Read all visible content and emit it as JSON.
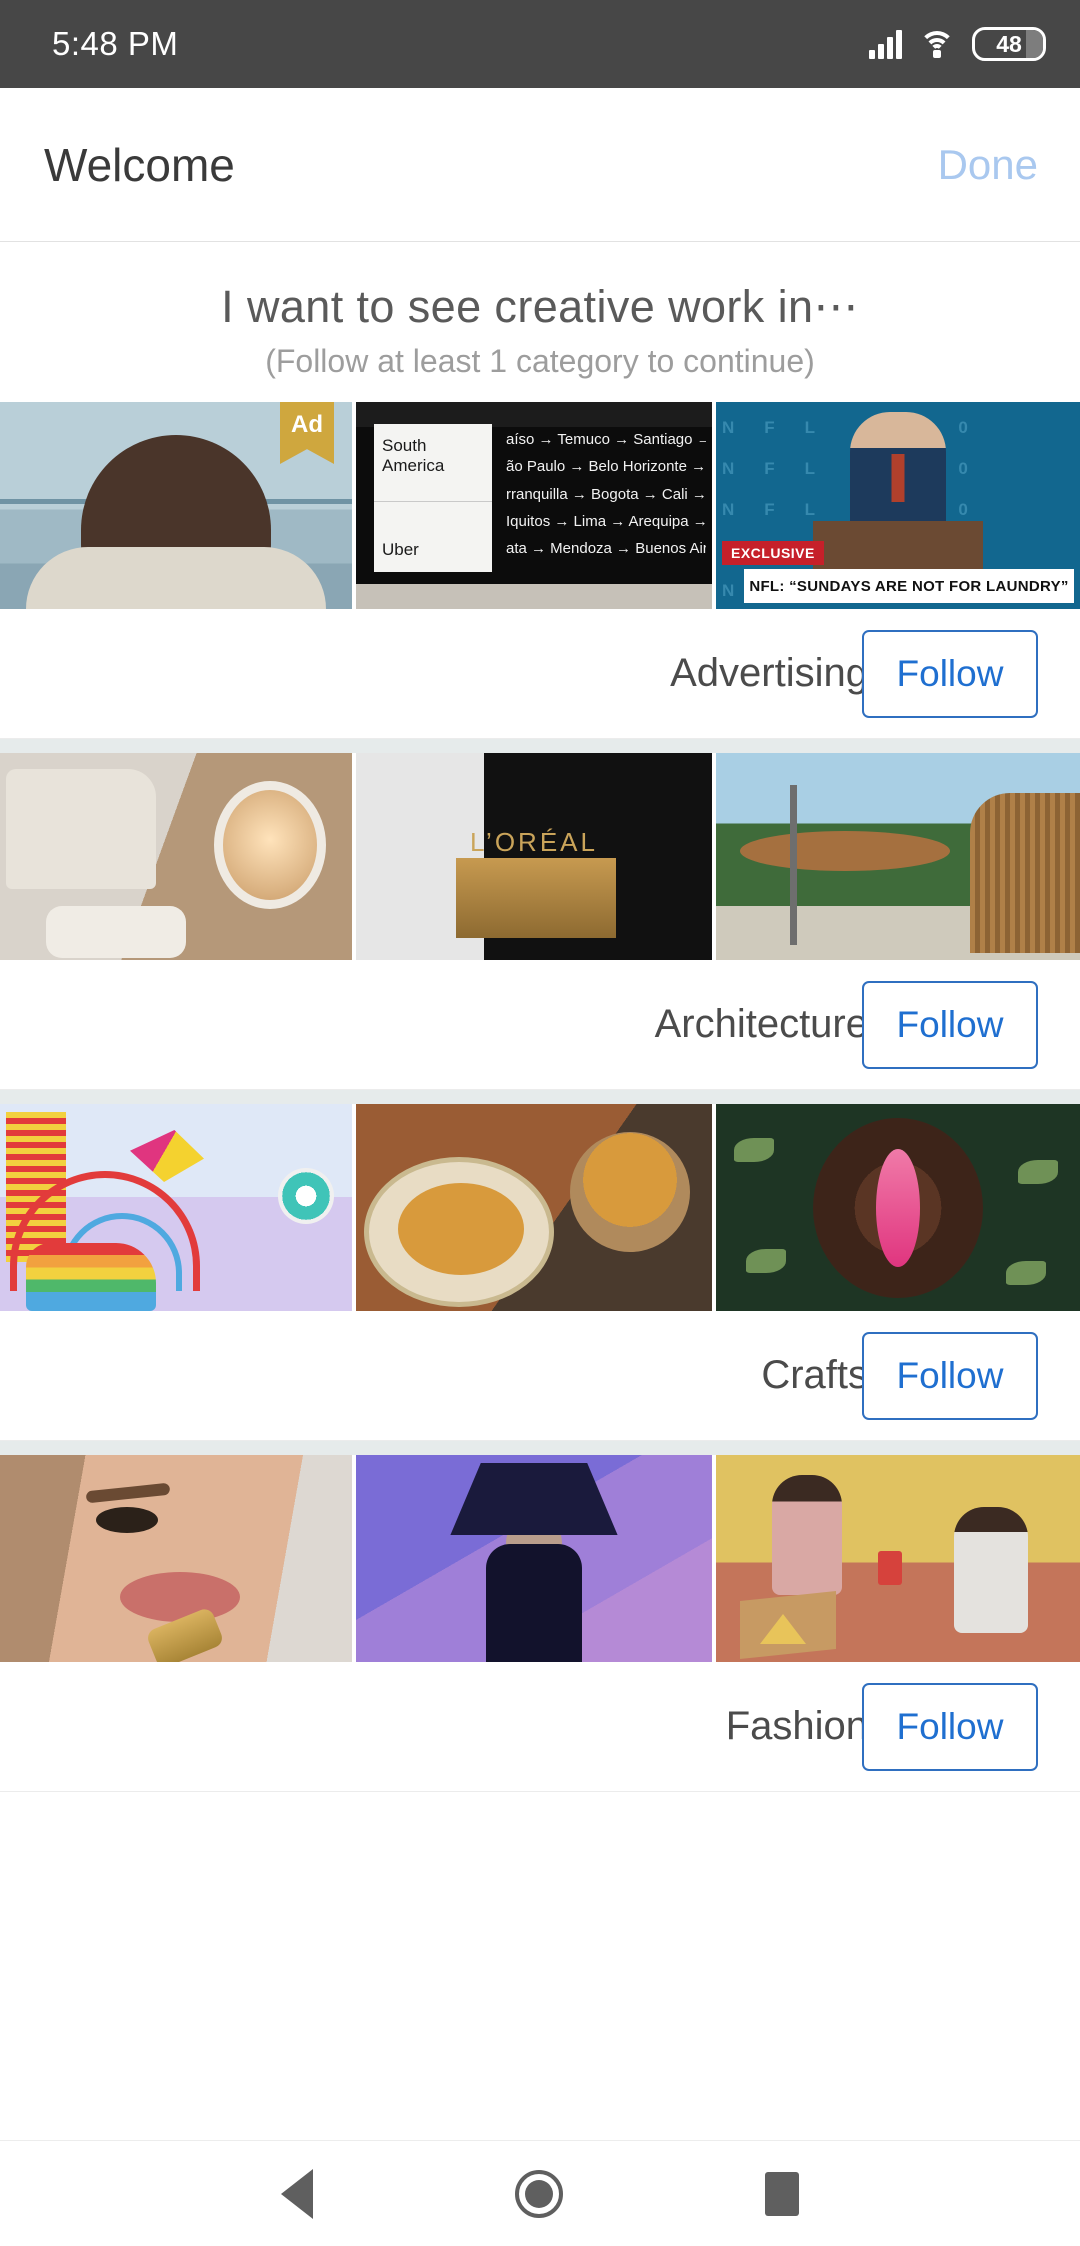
{
  "statusbar": {
    "time": "5:48 PM",
    "battery_level": "48",
    "icons": [
      "signal-icon",
      "wifi-icon",
      "battery-icon"
    ]
  },
  "header": {
    "title": "Welcome",
    "done_label": "Done"
  },
  "prompt": {
    "title": "I want to see creative work in⋯",
    "subtitle": "(Follow at least 1 category to continue)"
  },
  "colors": {
    "accent_blue": "#1f6fd0",
    "button_border": "#2f6fc0",
    "done_disabled": "#a9c8ef",
    "statusbar_bg": "#474747",
    "divider": "#e6ebeb",
    "ad_badge": "#cfa73e"
  },
  "categories": [
    {
      "name": "Advertising",
      "follow_label": "Follow",
      "thumbs": [
        {
          "alt": "man-portrait-mustache",
          "badge": "Ad"
        },
        {
          "alt": "uber-signage-board",
          "panel_line1": "South",
          "panel_line2": "America",
          "panel_line3": "Uber",
          "routes": [
            "aíso → Temuco → Santiago →",
            "ão Paulo → Belo Horizonte → R",
            "rranquilla → Bogota → Cali →",
            "Iquitos → Lima → Arequipa →",
            "ata → Mendoza → Buenos Air"
          ]
        },
        {
          "alt": "nfl-press-conference",
          "exclusive": "EXCLUSIVE",
          "caption": "NFL: “SUNDAYS ARE NOT FOR LAUNDRY”"
        }
      ]
    },
    {
      "name": "Architecture",
      "follow_label": "Follow",
      "thumbs": [
        {
          "alt": "airplane-cabin-interior"
        },
        {
          "alt": "loreal-lobby-interior",
          "logo": "L’ORÉAL"
        },
        {
          "alt": "wooden-pavilion-outdoor"
        }
      ]
    },
    {
      "name": "Crafts",
      "follow_label": "Follow",
      "thumbs": [
        {
          "alt": "carnival-illustration-rainbow-shoe"
        },
        {
          "alt": "ceramic-plate-hand-drawing"
        },
        {
          "alt": "paper-craft-flower-dark-green"
        }
      ]
    },
    {
      "name": "Fashion",
      "follow_label": "Follow",
      "thumbs": [
        {
          "alt": "beauty-closeup-portrait"
        },
        {
          "alt": "model-dark-dress-purple-backdrop"
        },
        {
          "alt": "two-women-pizza-studio"
        }
      ]
    }
  ],
  "navbar": {
    "back": "back-icon",
    "home": "home-icon",
    "recent": "recent-apps-icon"
  }
}
